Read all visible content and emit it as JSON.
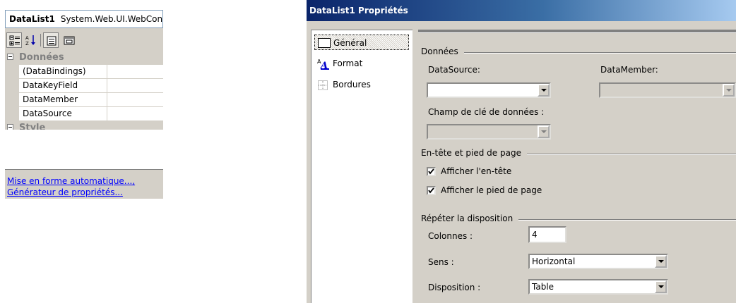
{
  "property_grid": {
    "object_name": "DataList1",
    "object_type": "System.Web.UI.WebControls.DataList",
    "toolbar": {
      "categorized_icon": "categorized-icon",
      "alphabetical_icon": "alphabetical-icon",
      "properties_icon": "properties-icon",
      "events_icon": "property-pages-icon"
    },
    "categories": [
      {
        "label": "Données",
        "properties": [
          {
            "name": "(DataBindings)",
            "value": ""
          },
          {
            "name": "DataKeyField",
            "value": ""
          },
          {
            "name": "DataMember",
            "value": ""
          },
          {
            "name": "DataSource",
            "value": ""
          }
        ]
      },
      {
        "label": "Style",
        "properties": []
      }
    ],
    "links": [
      "Mise en forme automatique...,",
      "Générateur de propriétés..."
    ]
  },
  "dialog": {
    "title": "DataList1 Propriétés",
    "nav": [
      {
        "label": "Général",
        "icon": "general-page-icon",
        "selected": true
      },
      {
        "label": "Format",
        "icon": "format-icon",
        "selected": false
      },
      {
        "label": "Bordures",
        "icon": "borders-icon",
        "selected": false
      }
    ],
    "data_group": {
      "label": "Données",
      "datasource_label": "DataSource:",
      "datasource_value": "",
      "datamember_label": "DataMember:",
      "datamember_value": "",
      "keyfield_label": "Champ de clé de données :",
      "keyfield_value": ""
    },
    "header_group": {
      "label": "En-tête et pied de page",
      "show_header_label": "Afficher l'en-tête",
      "show_header_checked": true,
      "show_footer_label": "Afficher le pied de page",
      "show_footer_checked": true
    },
    "layout_group": {
      "label": "Répéter la disposition",
      "columns_label": "Colonnes :",
      "columns_value": "4",
      "direction_label": "Sens :",
      "direction_value": "Horizontal",
      "layout_label": "Disposition :",
      "layout_value": "Table"
    }
  }
}
